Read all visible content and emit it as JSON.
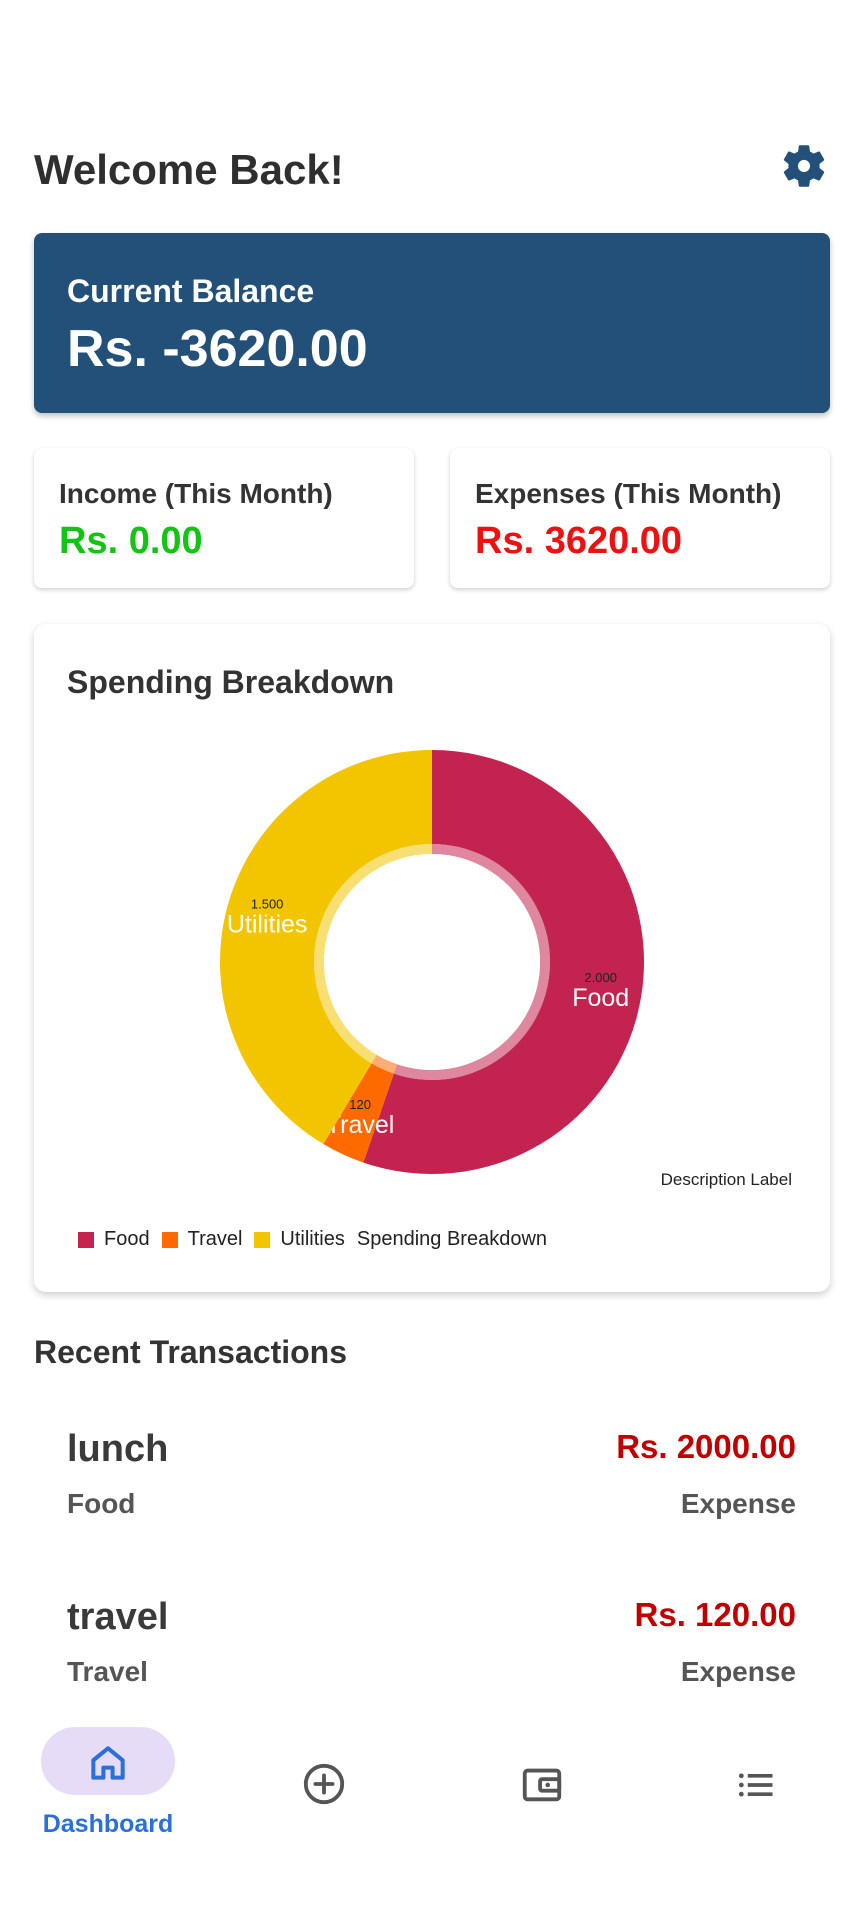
{
  "header": {
    "title": "Welcome Back!",
    "settings_icon": "gear-icon"
  },
  "balance": {
    "label": "Current Balance",
    "value": "Rs. -3620.00"
  },
  "income": {
    "label": "Income (This Month)",
    "value": "Rs. 0.00",
    "color": "#14c414"
  },
  "expenses": {
    "label": "Expenses (This Month)",
    "value": "Rs. 3620.00",
    "color": "#ee1111"
  },
  "chart_card": {
    "title": "Spending Breakdown",
    "description_label": "Description Label"
  },
  "chart_data": {
    "type": "pie",
    "title": "Spending Breakdown",
    "categories": [
      "Food",
      "Travel",
      "Utilities"
    ],
    "values": [
      2000,
      120,
      1500
    ],
    "value_labels": [
      "2.000",
      "120",
      "1.500"
    ],
    "colors": [
      "#c2244f",
      "#ff6a00",
      "#f2c500"
    ],
    "legend_placement": "bottom-left",
    "legend_title": "Spending Breakdown",
    "hole": true
  },
  "recent": {
    "title": "Recent Transactions",
    "items": [
      {
        "name": "lunch",
        "amount": "Rs. 2000.00",
        "category": "Food",
        "type": "Expense"
      },
      {
        "name": "travel",
        "amount": "Rs. 120.00",
        "category": "Travel",
        "type": "Expense"
      }
    ]
  },
  "nav": {
    "items": [
      {
        "label": "Dashboard",
        "icon": "home-icon",
        "active": true
      },
      {
        "label": "",
        "icon": "add-circle-icon",
        "active": false
      },
      {
        "label": "",
        "icon": "wallet-icon",
        "active": false
      },
      {
        "label": "",
        "icon": "list-icon",
        "active": false
      }
    ],
    "active_color": "#2b6fd8"
  }
}
